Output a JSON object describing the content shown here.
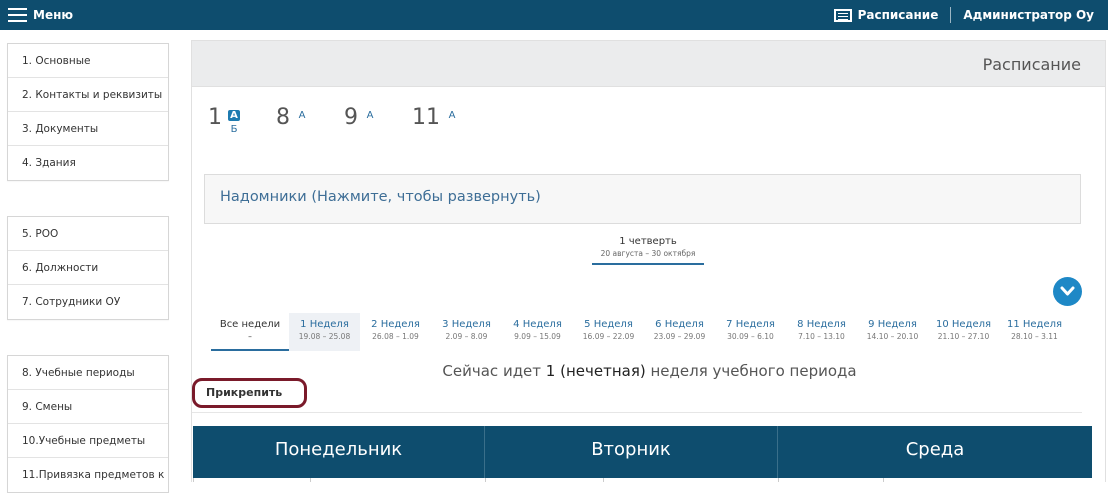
{
  "topbar": {
    "menu_label": "Меню",
    "schedule_label": "Расписание",
    "user_label": "Администратор Оу"
  },
  "sidebar": {
    "group1": [
      "1.  Основные",
      "2.  Контакты и реквизиты",
      "3.  Документы",
      "4.  Здания"
    ],
    "group2": [
      "5.  РОО",
      "6.  Должности",
      "7.  Сотрудники ОУ"
    ],
    "group3": [
      "8.  Учебные периоды",
      "9.  Смены",
      "10.Учебные предметы",
      "11.Привязка предметов к"
    ]
  },
  "panel": {
    "title": "Расписание"
  },
  "classes": [
    {
      "num": "1",
      "letters": [
        "А"
      ],
      "sub": "Б",
      "active": "А"
    },
    {
      "num": "8",
      "letters": [
        "А"
      ]
    },
    {
      "num": "9",
      "letters": [
        "А"
      ]
    },
    {
      "num": "11",
      "letters": [
        "А"
      ]
    }
  ],
  "homeschool": {
    "label": "Надомники (Нажмите, чтобы развернуть)"
  },
  "quarter": {
    "title": "1 четверть",
    "dates": "20 августа – 30 октября"
  },
  "weeks": [
    {
      "name": "Все недели",
      "dates": "–"
    },
    {
      "name": "1 Неделя",
      "dates": "19.08 – 25.08"
    },
    {
      "name": "2 Неделя",
      "dates": "26.08 – 1.09"
    },
    {
      "name": "3 Неделя",
      "dates": "2.09 – 8.09"
    },
    {
      "name": "4 Неделя",
      "dates": "9.09 – 15.09"
    },
    {
      "name": "5 Неделя",
      "dates": "16.09 – 22.09"
    },
    {
      "name": "6 Неделя",
      "dates": "23.09 – 29.09"
    },
    {
      "name": "7 Неделя",
      "dates": "30.09 – 6.10"
    },
    {
      "name": "8 Неделя",
      "dates": "7.10 – 13.10"
    },
    {
      "name": "9 Неделя",
      "dates": "14.10 – 20.10"
    },
    {
      "name": "10 Неделя",
      "dates": "21.10 – 27.10"
    },
    {
      "name": "11 Неделя",
      "dates": "28.10 – 3.11"
    }
  ],
  "current_week": {
    "prefix": "Сейчас идет ",
    "number": "1",
    "parity": "(нечетная)",
    "suffix": " неделя учебного периода"
  },
  "pin_button": {
    "label": "Прикрепить"
  },
  "days": [
    "Понедельник",
    "Вторник",
    "Среда"
  ],
  "colors": {
    "header_bg": "#0e4d6e",
    "accent": "#1e88c6",
    "pin_border": "#7a1a2a"
  }
}
